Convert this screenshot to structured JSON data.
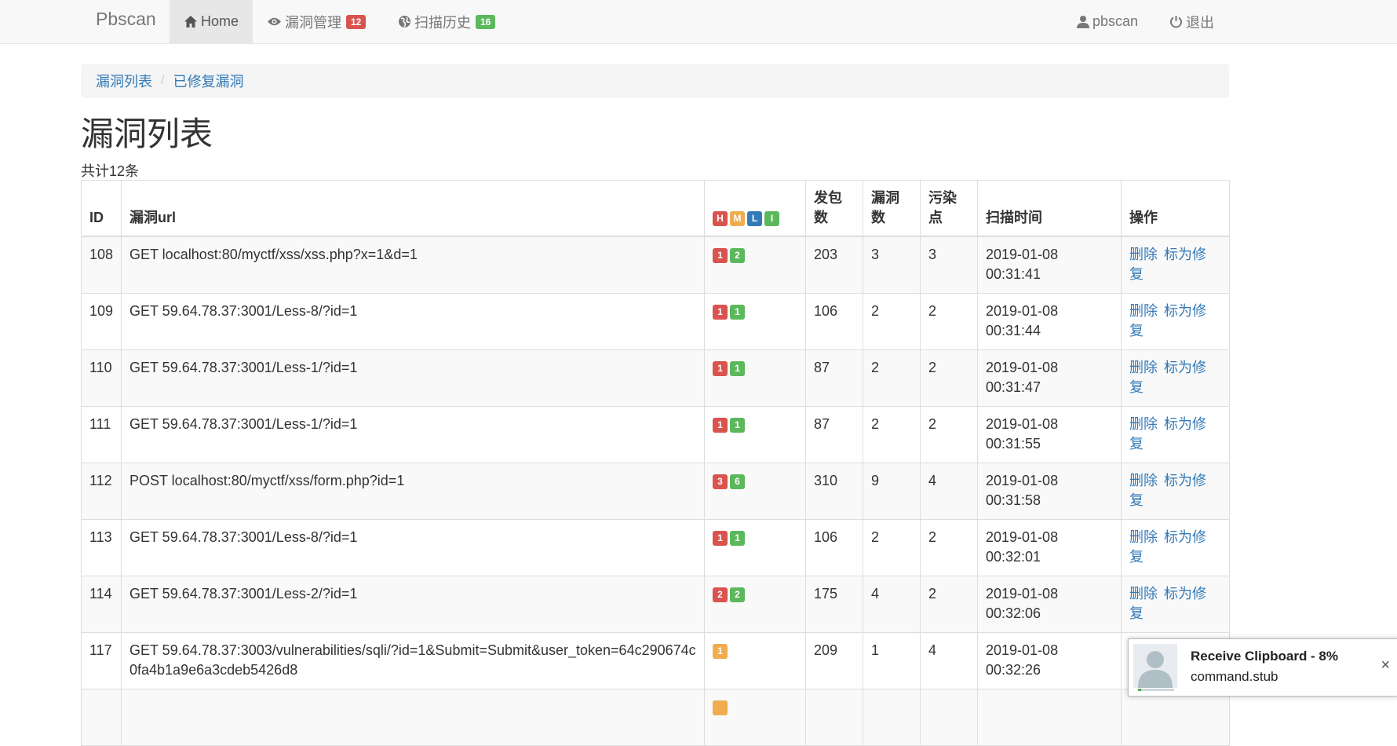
{
  "navbar": {
    "brand": "Pbscan",
    "items": [
      {
        "label": "Home",
        "icon": "home-icon"
      },
      {
        "label": "漏洞管理",
        "icon": "eye-icon",
        "badge": "12",
        "badge_color": "#d9534f"
      },
      {
        "label": "扫描历史",
        "icon": "globe-icon",
        "badge": "16",
        "badge_color": "#5cb85c"
      }
    ],
    "user": {
      "label": "pbscan",
      "icon": "user-icon"
    },
    "logout": {
      "label": "退出",
      "icon": "power-icon"
    }
  },
  "breadcrumb": {
    "items": [
      "漏洞列表",
      "已修复漏洞"
    ],
    "separator": "/"
  },
  "page": {
    "title": "漏洞列表",
    "count_text": "共计12条"
  },
  "table": {
    "headers": {
      "id": "ID",
      "url": "漏洞url",
      "severity": [
        "H",
        "M",
        "L",
        "I"
      ],
      "packets": "发包数",
      "vulns": "漏洞数",
      "taint": "污染点",
      "time": "扫描时间",
      "ops": "操作"
    },
    "severity_colors": {
      "H": "#d9534f",
      "M": "#f0ad4e",
      "L": "#337ab7",
      "I": "#5cb85c"
    },
    "op_labels": {
      "delete": "删除",
      "mark_fixed": "标为修复"
    },
    "rows": [
      {
        "id": "108",
        "url": "GET localhost:80/myctf/xss/xss.php?x=1&d=1",
        "badges": [
          {
            "level": "H",
            "count": "1"
          },
          {
            "level": "I",
            "count": "2"
          }
        ],
        "packets": "203",
        "vulns": "3",
        "taint": "3",
        "date": "2019-01-08",
        "time": "00:31:41"
      },
      {
        "id": "109",
        "url": "GET 59.64.78.37:3001/Less-8/?id=1",
        "badges": [
          {
            "level": "H",
            "count": "1"
          },
          {
            "level": "I",
            "count": "1"
          }
        ],
        "packets": "106",
        "vulns": "2",
        "taint": "2",
        "date": "2019-01-08",
        "time": "00:31:44"
      },
      {
        "id": "110",
        "url": "GET 59.64.78.37:3001/Less-1/?id=1",
        "badges": [
          {
            "level": "H",
            "count": "1"
          },
          {
            "level": "I",
            "count": "1"
          }
        ],
        "packets": "87",
        "vulns": "2",
        "taint": "2",
        "date": "2019-01-08",
        "time": "00:31:47"
      },
      {
        "id": "111",
        "url": "GET 59.64.78.37:3001/Less-1/?id=1",
        "badges": [
          {
            "level": "H",
            "count": "1"
          },
          {
            "level": "I",
            "count": "1"
          }
        ],
        "packets": "87",
        "vulns": "2",
        "taint": "2",
        "date": "2019-01-08",
        "time": "00:31:55"
      },
      {
        "id": "112",
        "url": "POST localhost:80/myctf/xss/form.php?id=1",
        "badges": [
          {
            "level": "H",
            "count": "3"
          },
          {
            "level": "I",
            "count": "6"
          }
        ],
        "packets": "310",
        "vulns": "9",
        "taint": "4",
        "date": "2019-01-08",
        "time": "00:31:58"
      },
      {
        "id": "113",
        "url": "GET 59.64.78.37:3001/Less-8/?id=1",
        "badges": [
          {
            "level": "H",
            "count": "1"
          },
          {
            "level": "I",
            "count": "1"
          }
        ],
        "packets": "106",
        "vulns": "2",
        "taint": "2",
        "date": "2019-01-08",
        "time": "00:32:01"
      },
      {
        "id": "114",
        "url": "GET 59.64.78.37:3001/Less-2/?id=1",
        "badges": [
          {
            "level": "H",
            "count": "2"
          },
          {
            "level": "I",
            "count": "2"
          }
        ],
        "packets": "175",
        "vulns": "4",
        "taint": "2",
        "date": "2019-01-08",
        "time": "00:32:06"
      },
      {
        "id": "117",
        "url": "GET 59.64.78.37:3003/vulnerabilities/sqli/?id=1&Submit=Submit&user_token=64c290674c0fa4b1a9e6a3cdeb5426d8",
        "badges": [
          {
            "level": "M",
            "count": "1"
          }
        ],
        "packets": "209",
        "vulns": "1",
        "taint": "4",
        "date": "2019-01-08",
        "time": "00:32:26"
      },
      {
        "id": "",
        "url": "",
        "badges": [
          {
            "level": "M",
            "count": ""
          }
        ],
        "packets": "",
        "vulns": "",
        "taint": "",
        "date": "",
        "time": ""
      }
    ]
  },
  "toast": {
    "title": "Receive Clipboard - 8%",
    "progress_percent": 8,
    "body": "command.stub",
    "close_label": "×",
    "avatar_icon": "user-avatar-icon",
    "close_icon": "close-icon"
  }
}
